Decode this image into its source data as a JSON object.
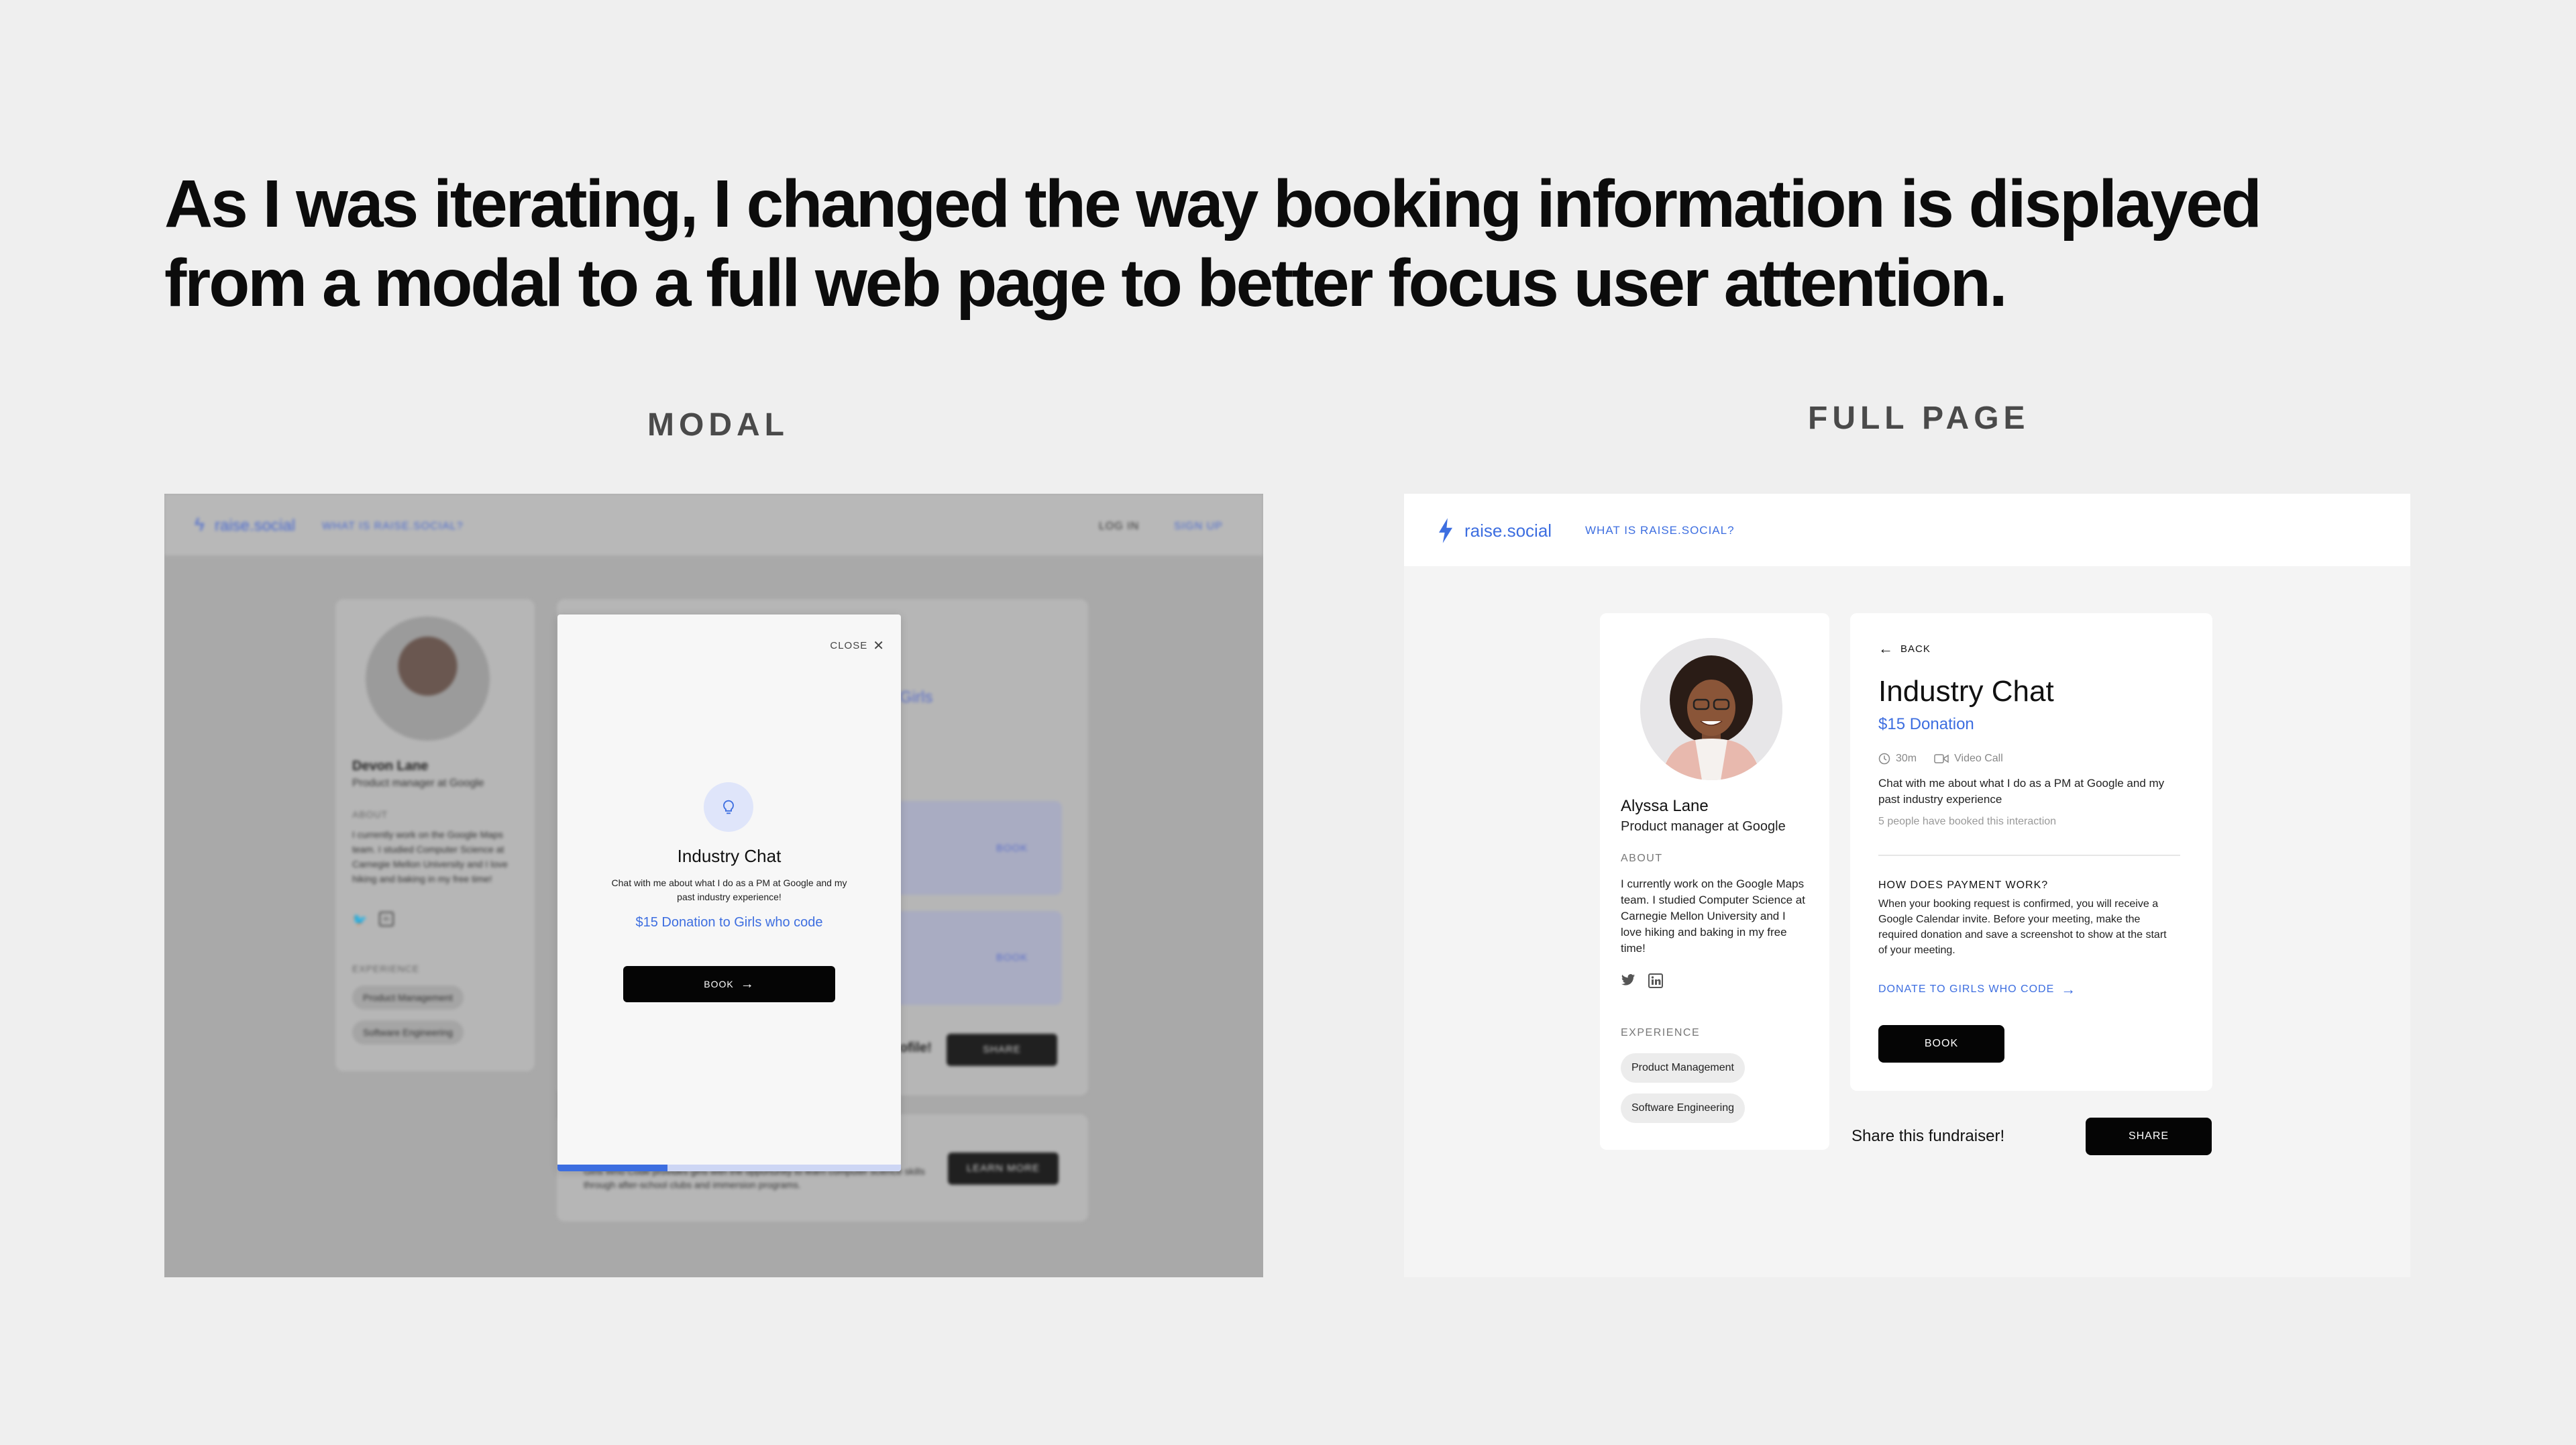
{
  "headline": {
    "line1": "As I was iterating, I changed the way booking information is displayed",
    "line2": "from a modal to a full web page to better focus user attention."
  },
  "labels": {
    "modal": "MODAL",
    "full_page": "FULL PAGE"
  },
  "modal_screen": {
    "nav": {
      "logo": "raise.social",
      "what": "WHAT IS RAISE.SOCIAL?",
      "login": "LOG IN",
      "signup": "SIGN UP"
    },
    "background": {
      "name": "Devon Lane",
      "role": "Product manager at Google",
      "about_heading": "ABOUT",
      "about": "I currently work on the Google Maps team. I studied Computer Science at Carnegie Mellon University and I love hiking and baking in my free time!",
      "experience_heading": "EXPERIENCE",
      "experience": [
        "Product Management",
        "Software Engineering"
      ],
      "block_book": "BOOK",
      "share_label": "SHARE",
      "learn_more": "LEARN MORE",
      "girls_fragment": "Girls",
      "profile_fragment": "ofile!",
      "bottom_text": "Girls Who Code provides girls with the opportunity to learn computer science skills through after-school clubs and immersion programs."
    },
    "modal": {
      "close": "CLOSE",
      "icon": "lightbulb-icon",
      "title": "Industry Chat",
      "description": "Chat with me about what I do as a PM at Google and my past industry experience!",
      "donation": "$15 Donation to Girls who code",
      "book": "BOOK",
      "progress": 0.32
    }
  },
  "full_screen": {
    "nav": {
      "logo": "raise.social",
      "what": "WHAT IS RAISE.SOCIAL?"
    },
    "profile": {
      "name": "Alyssa Lane",
      "role": "Product manager at Google",
      "about_heading": "ABOUT",
      "about": "I currently work on the Google Maps team. I studied Computer Science at Carnegie Mellon University and I love hiking and baking in my free time!",
      "experience_heading": "EXPERIENCE",
      "experience": [
        "Product Management",
        "Software Engineering"
      ]
    },
    "detail": {
      "back": "BACK",
      "title": "Industry Chat",
      "donation": "$15 Donation",
      "duration": "30m",
      "call_type": "Video Call",
      "description": "Chat with me about what I do as a PM at Google and my past industry experience",
      "booked": "5 people have booked this interaction",
      "payment_heading": "HOW DOES PAYMENT WORK?",
      "payment_text": "When your booking request is confirmed, you will receive a Google Calendar invite. Before your meeting, make the required donation and save a screenshot to show at the start of your meeting.",
      "donate_link": "DONATE TO GIRLS WHO CODE",
      "book": "BOOK"
    },
    "share": {
      "text": "Share this fundraiser!",
      "button": "SHARE"
    }
  },
  "colors": {
    "accent": "#3d6ee0",
    "button": "#050505",
    "page_bg": "#efefef"
  }
}
